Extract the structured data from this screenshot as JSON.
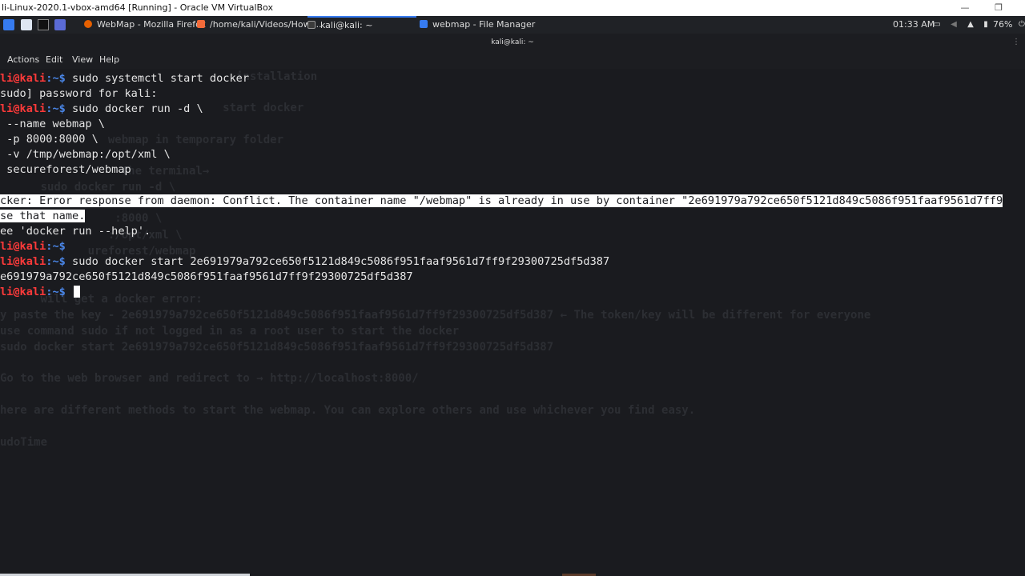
{
  "window": {
    "title": "li-Linux-2020.1-vbox-amd64 [Running] - Oracle VM VirtualBox",
    "minimize_glyph": "—",
    "restore_glyph": "❐"
  },
  "panel": {
    "tasks": [
      {
        "label": "WebMap - Mozilla Firefox",
        "icon": "firefox-icon",
        "color": "#e66000"
      },
      {
        "label": "/home/kali/Videos/How ...",
        "icon": "document-icon",
        "color": "#f36b3a"
      },
      {
        "label": "kali@kali: ~",
        "icon": "terminal-icon",
        "color": "#3b3b3b"
      },
      {
        "label": "webmap - File Manager",
        "icon": "folder-icon",
        "color": "#367bf0"
      }
    ],
    "clock": "01:33 AM",
    "battery": "76%"
  },
  "terminal": {
    "header_title": "kali@kali: ~",
    "menu": [
      "Actions",
      "Edit",
      "View",
      "Help"
    ],
    "ghost_lines": [
      "                                   installation",
      "                                 start docker",
      "                webmap in temporary folder",
      "                  the terminal→",
      "      sudo docker run -d \\",
      "",
      "                 :8000 \\",
      "                :/opt/xml \\",
      "             ureforest/webmap",
      "",
      "      will get a docker error:",
      "y paste the key - 2e691979a792ce650f5121d849c5086f951faaf9561d7ff9f29300725df5d387 ← The token/key will be different for everyone",
      "use command sudo if not logged in as a root user to start the docker",
      "sudo docker start 2e691979a792ce650f5121d849c5086f951faaf9561d7ff9f29300725df5d387",
      "",
      "Go to the web browser and redirect to → http://localhost:8000/",
      "",
      "here are different methods to start the webmap. You can explore others and use whichever you find easy.",
      "",
      "udoTime"
    ],
    "lines": {
      "l0_user": "li@kali",
      "l0_prompt": ":~$",
      "l0_cmd": " sudo systemctl start docker",
      "l1": "sudo] password for kali:",
      "l2_user": "li@kali",
      "l2_prompt": ":~$",
      "l2_cmd": " sudo docker run -d \\",
      "l3": " --name webmap \\",
      "l4": " -p 8000:8000 \\",
      "l5": " -v /tmp/webmap:/opt/xml \\",
      "l6": " secureforest/webmap",
      "l8": "cker: Error response from daemon: Conflict. The container name \"/webmap\" is already in use by container \"2e691979a792ce650f5121d849c5086f951faaf9561d7ff9",
      "l9": "se that name.",
      "l10": "ee 'docker run --help'.",
      "l11_user": "li@kali",
      "l11_prompt": ":~$",
      "l12_user": "li@kali",
      "l12_prompt": ":~$",
      "l12_cmd": " sudo docker start 2e691979a792ce650f5121d849c5086f951faaf9561d7ff9f29300725df5d387",
      "l13": "e691979a792ce650f5121d849c5086f951faaf9561d7ff9f29300725df5d387",
      "l14_user": "li@kali",
      "l14_prompt": ":~$"
    }
  }
}
